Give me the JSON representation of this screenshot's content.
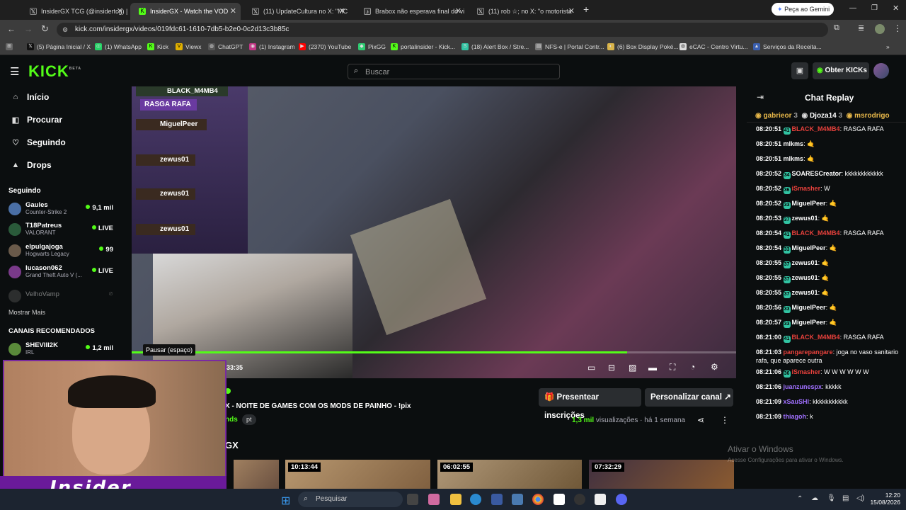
{
  "browser": {
    "tabs": [
      {
        "title": "InsiderGX TCG (@insidertcg) | T",
        "active": false
      },
      {
        "title": "InsiderGX - Watch the VOD",
        "active": true
      },
      {
        "title": "(11) UpdateCultura no X: \"MC F",
        "active": false
      },
      {
        "title": "Brabox não esperava final do vi",
        "active": false
      },
      {
        "title": "(11) rob ☆; no X: \"o motorista",
        "active": false
      }
    ],
    "gemini_button": "Peça ao Gemini",
    "url": "kick.com/insidergx/videos/019fdc61-1610-7db5-b2e0-0c2d13c3b85c",
    "bookmarks": [
      "(5) Página Inicial / X",
      "(1) WhatsApp",
      "Kick",
      "Viewx",
      "ChatGPT",
      "(1) Instagram",
      "(2370) YouTube",
      "PixGG",
      "portalinsider - Kick...",
      "(18) Alert Box / Stre...",
      "NFS-e | Portal Contr...",
      "(6) Box Display Poké...",
      "eCAC - Centro Virtu...",
      "Serviços da Receita..."
    ]
  },
  "kick": {
    "logo": "KICK",
    "logo_sup": "BETA",
    "search_placeholder": "Buscar",
    "get_kicks": "Obter KICKs",
    "nav": [
      "Início",
      "Procurar",
      "Seguindo",
      "Drops"
    ],
    "following_header": "Seguindo",
    "following": [
      {
        "name": "Gaules",
        "game": "Counter-Strike 2",
        "viewers": "9,1 mil",
        "color": "#4a6fa5"
      },
      {
        "name": "T18Patreus",
        "game": "VALORANT",
        "viewers": "LIVE",
        "color": "#2a5a3a"
      },
      {
        "name": "elpulgajoga",
        "game": "Hogwarts Legacy",
        "viewers": "99",
        "color": "#6a5a4a"
      },
      {
        "name": "lucason062",
        "game": "Grand Theft Auto V (...",
        "viewers": "LIVE",
        "color": "#7a3a8a"
      },
      {
        "name": "VelhoVamp",
        "game": "",
        "viewers": "",
        "color": "#555555"
      }
    ],
    "show_more": "Mostrar Mais",
    "recommended_header": "CANAIS RECOMENDADOS",
    "recommended": [
      {
        "name": "SHEVIII2K",
        "game": "IRL",
        "viewers": "1,2 mil",
        "color": "#5a8a3a"
      }
    ]
  },
  "video": {
    "tooltip": "Pausar (espaço)",
    "time": "33:35",
    "progress": 0.82,
    "overlay_names": [
      "BLACK_M4MB4",
      "RASGA RAFA",
      "MiguelPeer",
      "zewus01",
      "zewus01",
      "zewus01"
    ],
    "title": "X - NOITE DE GAMES COM OS MODS DE PAINHO - !pix",
    "category": "nds",
    "language": "pt",
    "views": "1,3 mil",
    "views_label": "visualizações",
    "age": "há 1 semana",
    "gift_button": "Presentear inscrições",
    "customize_button": "Personalizar canal",
    "section_title": "GX",
    "thumbnails": [
      "10:13:44",
      "06:02:55",
      "07:32:29"
    ]
  },
  "chat": {
    "title": "Chat Replay",
    "top_gifters": [
      {
        "name": "gabrieor",
        "count": "3"
      },
      {
        "name": "Djoza14",
        "count": "3"
      },
      {
        "name": "msrodrigo",
        "count": ""
      }
    ],
    "messages": [
      {
        "time": "08:20:51",
        "user": "BLACK_M4MB4",
        "color": "#e8413c",
        "text": "RASGA RAFA",
        "badge": "41"
      },
      {
        "time": "08:20:51",
        "user": "mlkms",
        "color": "#ffffff",
        "text": "🤙",
        "badge": ""
      },
      {
        "time": "08:20:51",
        "user": "mlkms",
        "color": "#ffffff",
        "text": "🤙",
        "badge": ""
      },
      {
        "time": "08:20:52",
        "user": "SOARESCreator",
        "color": "#ffffff",
        "text": "kkkkkkkkkkkk",
        "badge": "34"
      },
      {
        "time": "08:20:52",
        "user": "iSmasher",
        "color": "#e8413c",
        "text": "W",
        "badge": "36"
      },
      {
        "time": "08:20:52",
        "user": "MiguelPeer",
        "color": "#ffffff",
        "text": "🤙",
        "badge": "33"
      },
      {
        "time": "08:20:53",
        "user": "zewus01",
        "color": "#ffffff",
        "text": "🤙",
        "badge": "37"
      },
      {
        "time": "08:20:54",
        "user": "BLACK_M4MB4",
        "color": "#e8413c",
        "text": "RASGA RAFA",
        "badge": "41"
      },
      {
        "time": "08:20:54",
        "user": "MiguelPeer",
        "color": "#ffffff",
        "text": "🤙",
        "badge": "33"
      },
      {
        "time": "08:20:55",
        "user": "zewus01",
        "color": "#ffffff",
        "text": "🤙",
        "badge": "37"
      },
      {
        "time": "08:20:55",
        "user": "zewus01",
        "color": "#ffffff",
        "text": "🤙",
        "badge": "37"
      },
      {
        "time": "08:20:55",
        "user": "zewus01",
        "color": "#ffffff",
        "text": "🤙",
        "badge": "37"
      },
      {
        "time": "08:20:56",
        "user": "MiguelPeer",
        "color": "#ffffff",
        "text": "🤙",
        "badge": "33"
      },
      {
        "time": "08:20:57",
        "user": "MiguelPeer",
        "color": "#ffffff",
        "text": "🤙",
        "badge": "33"
      },
      {
        "time": "08:21:00",
        "user": "BLACK_M4MB4",
        "color": "#e8413c",
        "text": "RASGA RAFA",
        "badge": "41"
      },
      {
        "time": "08:21:03",
        "user": "pangarepangare",
        "color": "#e8413c",
        "text": "joga no vaso sanitario rafa, que aparece outra",
        "badge": ""
      },
      {
        "time": "08:21:06",
        "user": "iSmasher",
        "color": "#e8413c",
        "text": "W W W W W W",
        "badge": "36"
      },
      {
        "time": "08:21:06",
        "user": "juanzunespx",
        "color": "#a070ff",
        "text": "kkkkk",
        "badge": ""
      },
      {
        "time": "08:21:09",
        "user": "xSauSHI",
        "color": "#a070ff",
        "text": "kkkkkkkkkkk",
        "badge": ""
      },
      {
        "time": "08:21:09",
        "user": "thiagoh",
        "color": "#a070ff",
        "text": "k",
        "badge": ""
      }
    ]
  },
  "webcam": {
    "logo_text": "Insider"
  },
  "windows": {
    "activate_title": "Ativar o Windows",
    "activate_sub": "Acesse Configurações para ativar o Windows.",
    "search_placeholder": "Pesquisar",
    "time": "12:20",
    "date": "15/08/2026"
  },
  "colors": {
    "kick_green": "#53fc18",
    "background": "#0b0e0f",
    "chat_red": "#e8413c"
  }
}
